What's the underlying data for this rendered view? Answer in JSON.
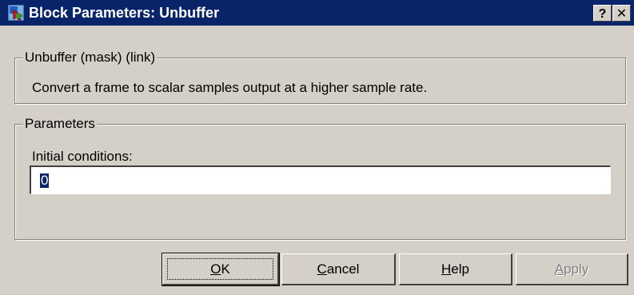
{
  "window": {
    "title": "Block Parameters: Unbuffer",
    "help_glyph": "?",
    "close_glyph": "✕",
    "icon": "simulink-block-icon"
  },
  "description_group": {
    "legend": "Unbuffer (mask) (link)",
    "text": "Convert a frame to scalar samples output at a higher sample rate."
  },
  "parameters_group": {
    "legend": "Parameters",
    "initial_conditions": {
      "label": "Initial conditions:",
      "value": "0"
    }
  },
  "buttons": {
    "ok": {
      "first": "O",
      "rest": "K"
    },
    "cancel": {
      "first": "C",
      "rest": "ancel"
    },
    "help": {
      "first": "H",
      "rest": "elp"
    },
    "apply": {
      "first": "A",
      "rest": "pply"
    }
  },
  "colors": {
    "titlebar": "#0a246a",
    "dialog_bg": "#d4d0c8",
    "selection": "#0a246a",
    "disabled_text": "#808080"
  }
}
